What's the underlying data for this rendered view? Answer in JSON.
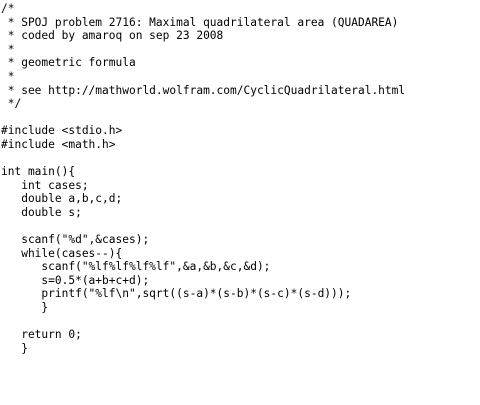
{
  "source": {
    "lines": [
      "/*",
      " * SPOJ problem 2716: Maximal quadrilateral area (QUADAREA)",
      " * coded by amaroq on sep 23 2008",
      " *",
      " * geometric formula",
      " *",
      " * see http://mathworld.wolfram.com/CyclicQuadrilateral.html",
      " */",
      "",
      "#include <stdio.h>",
      "#include <math.h>",
      "",
      "int main(){",
      "   int cases;",
      "   double a,b,c,d;",
      "   double s;",
      "",
      "   scanf(\"%d\",&cases);",
      "   while(cases--){",
      "      scanf(\"%lf%lf%lf%lf\",&a,&b,&c,&d);",
      "      s=0.5*(a+b+c+d);",
      "      printf(\"%lf\\n\",sqrt((s-a)*(s-b)*(s-c)*(s-d)));",
      "      }",
      "",
      "   return 0;",
      "   }"
    ]
  }
}
